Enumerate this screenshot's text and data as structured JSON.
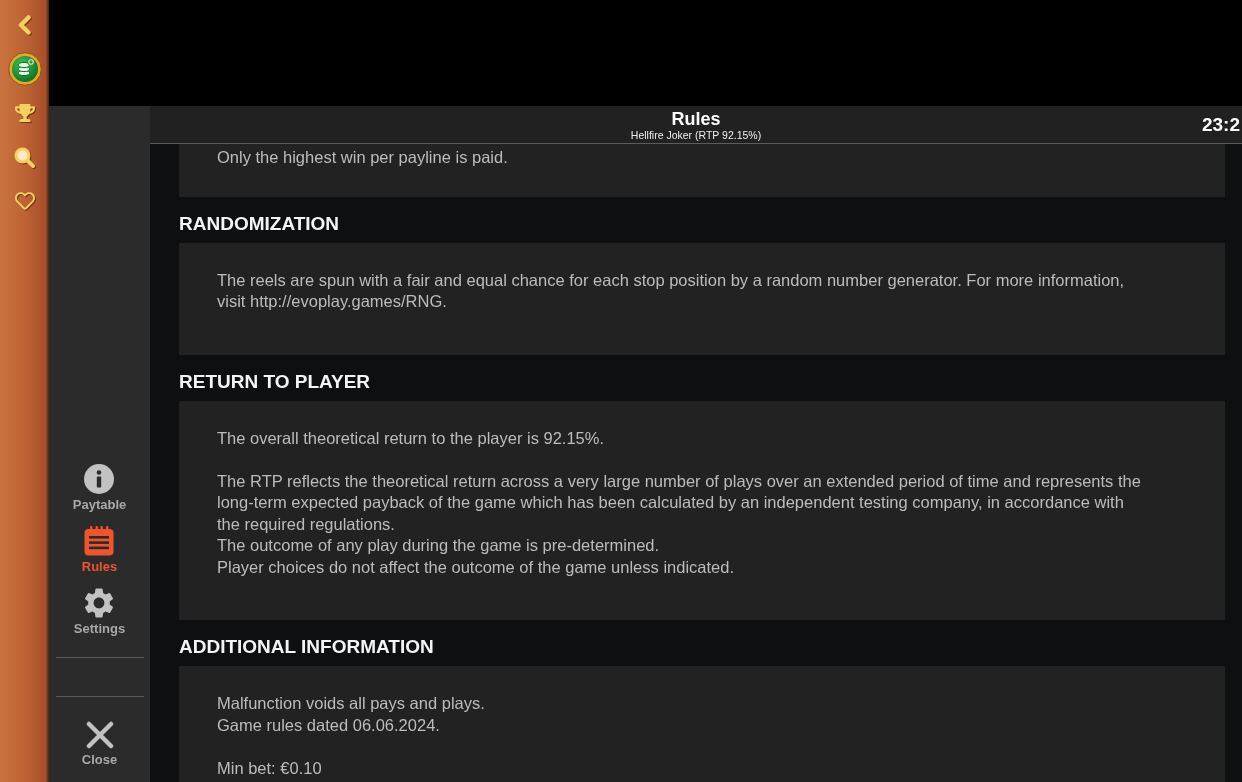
{
  "side_rail": {
    "buttons": [
      {
        "kind": "back"
      },
      {
        "kind": "coins"
      },
      {
        "kind": "trophy"
      },
      {
        "kind": "search"
      },
      {
        "kind": "heart"
      }
    ]
  },
  "header": {
    "title": "Rules",
    "subtitle": "Hellfire Joker (RTP 92.15%)",
    "clock": "23:2"
  },
  "nav": {
    "items": [
      {
        "kind": "info",
        "label": "Paytable",
        "selected": false
      },
      {
        "kind": "rules",
        "label": "Rules",
        "selected": true
      },
      {
        "kind": "settings",
        "label": "Settings",
        "selected": false
      }
    ],
    "close": {
      "label": "Close"
    }
  },
  "sections": [
    {
      "groups": [
        [
          "Only the highest win per payline is paid."
        ]
      ]
    },
    {
      "heading": "RANDOMIZATION",
      "groups": [
        [
          "The reels are spun with a fair and equal chance for each stop position by a random number generator. For more information,\nvisit http://evoplay.games/RNG."
        ]
      ]
    },
    {
      "heading": "RETURN TO PLAYER",
      "groups": [
        [
          "The overall theoretical return to the player is 92.15%."
        ],
        [
          "The RTP reflects the theoretical return across a very large number of plays over an extended period of time and represents the\nlong-term expected payback of the game which has been calculated by an independent testing company, in accordance with\nthe required regulations.",
          "The outcome of any play during the game is pre-determined.",
          "Player choices do not affect the outcome of the game unless indicated."
        ]
      ]
    },
    {
      "heading": "ADDITIONAL INFORMATION",
      "groups": [
        [
          "Malfunction voids all pays and plays.",
          "Game rules dated 06.06.2024."
        ],
        [
          "Min bet: €0.10"
        ]
      ]
    }
  ]
}
